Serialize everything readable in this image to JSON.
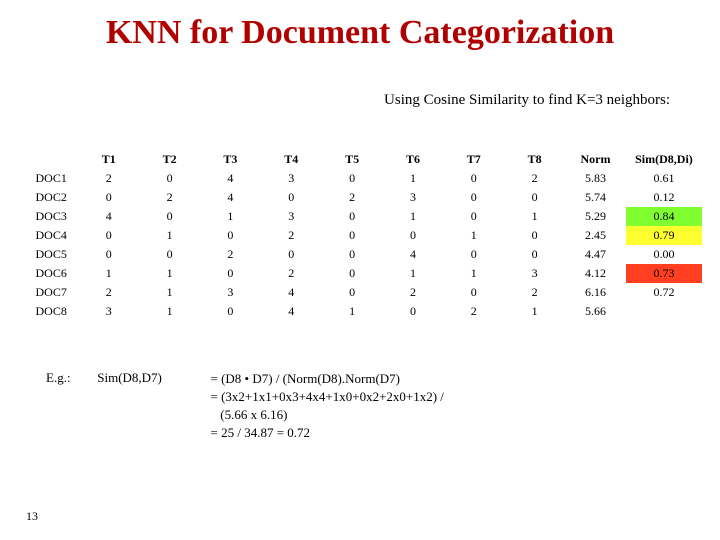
{
  "title": "KNN for Document Categorization",
  "subtitle": "Using Cosine Similarity to find K=3 neighbors:",
  "columns": [
    "T1",
    "T2",
    "T3",
    "T4",
    "T5",
    "T6",
    "T7",
    "T8",
    "Norm",
    "Sim(D8,Di)"
  ],
  "rows": [
    {
      "name": "DOC1",
      "v": [
        "2",
        "0",
        "4",
        "3",
        "0",
        "1",
        "0",
        "2"
      ],
      "norm": "5.83",
      "sim": "0.61",
      "hl": ""
    },
    {
      "name": "DOC2",
      "v": [
        "0",
        "2",
        "4",
        "0",
        "2",
        "3",
        "0",
        "0"
      ],
      "norm": "5.74",
      "sim": "0.12",
      "hl": ""
    },
    {
      "name": "DOC3",
      "v": [
        "4",
        "0",
        "1",
        "3",
        "0",
        "1",
        "0",
        "1"
      ],
      "norm": "5.29",
      "sim": "0.84",
      "hl": "green"
    },
    {
      "name": "DOC4",
      "v": [
        "0",
        "1",
        "0",
        "2",
        "0",
        "0",
        "1",
        "0"
      ],
      "norm": "2.45",
      "sim": "0.79",
      "hl": "yellow"
    },
    {
      "name": "DOC5",
      "v": [
        "0",
        "0",
        "2",
        "0",
        "0",
        "4",
        "0",
        "0"
      ],
      "norm": "4.47",
      "sim": "0.00",
      "hl": ""
    },
    {
      "name": "DOC6",
      "v": [
        "1",
        "1",
        "0",
        "2",
        "0",
        "1",
        "1",
        "3"
      ],
      "norm": "4.12",
      "sim": "0.73",
      "hl": "red"
    },
    {
      "name": "DOC7",
      "v": [
        "2",
        "1",
        "3",
        "4",
        "0",
        "2",
        "0",
        "2"
      ],
      "norm": "6.16",
      "sim": "0.72",
      "hl": ""
    },
    {
      "name": "DOC8",
      "v": [
        "3",
        "1",
        "0",
        "4",
        "1",
        "0",
        "2",
        "1"
      ],
      "norm": "5.66",
      "sim": "",
      "hl": ""
    }
  ],
  "example": {
    "eg_label": "E.g.:",
    "sim_label": "Sim(D8,D7)",
    "line1": "= (D8 • D7) / (Norm(D8).Norm(D7)",
    "line2": "= (3x2+1x1+0x3+4x4+1x0+0x2+2x0+1x2) /",
    "line3": "   (5.66 x 6.16)",
    "line4": "= 25 / 34.87 = 0.72"
  },
  "page_number": "13",
  "chart_data": {
    "type": "table",
    "title": "KNN for Document Categorization",
    "columns": [
      "T1",
      "T2",
      "T3",
      "T4",
      "T5",
      "T6",
      "T7",
      "T8",
      "Norm",
      "Sim(D8,Di)"
    ],
    "data": {
      "DOC1": [
        2,
        0,
        4,
        3,
        0,
        1,
        0,
        2,
        5.83,
        0.61
      ],
      "DOC2": [
        0,
        2,
        4,
        0,
        2,
        3,
        0,
        0,
        5.74,
        0.12
      ],
      "DOC3": [
        4,
        0,
        1,
        3,
        0,
        1,
        0,
        1,
        5.29,
        0.84
      ],
      "DOC4": [
        0,
        1,
        0,
        2,
        0,
        0,
        1,
        0,
        2.45,
        0.79
      ],
      "DOC5": [
        0,
        0,
        2,
        0,
        0,
        4,
        0,
        0,
        4.47,
        0.0
      ],
      "DOC6": [
        1,
        1,
        0,
        2,
        0,
        1,
        1,
        3,
        4.12,
        0.73
      ],
      "DOC7": [
        2,
        1,
        3,
        4,
        0,
        2,
        0,
        2,
        6.16,
        0.72
      ],
      "DOC8": [
        3,
        1,
        0,
        4,
        1,
        0,
        2,
        1,
        5.66,
        null
      ]
    },
    "highlighted_neighbors": {
      "DOC3": "green",
      "DOC4": "yellow",
      "DOC6": "red"
    }
  }
}
